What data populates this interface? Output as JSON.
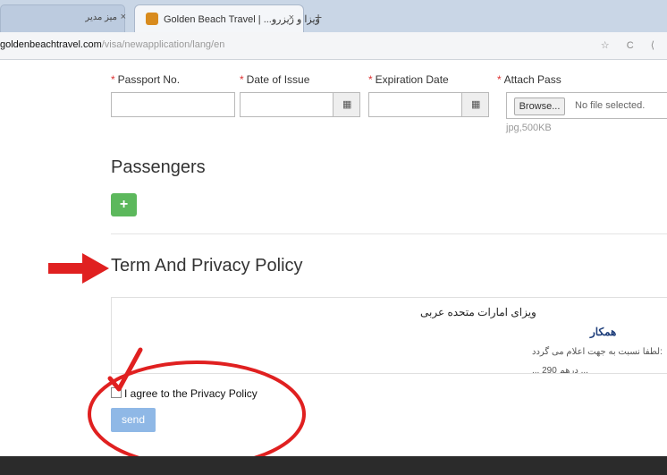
{
  "browser": {
    "tabs": [
      {
        "label": "میز مدیر",
        "close": "×",
        "active": false
      },
      {
        "label": "Golden Beach Travel | ...ویزا و ریزرو",
        "close": "×",
        "active": true
      }
    ],
    "new_tab": "+",
    "url_host": "goldenbeachtravel.com",
    "url_path": "/visa/newapplication/lang/en",
    "nav_icons": "☆ C ⟨"
  },
  "form": {
    "fields": [
      {
        "label": "Passport No.",
        "required": true
      },
      {
        "label": "Date of Issue",
        "required": true,
        "calendar": true
      },
      {
        "label": "Expiration Date",
        "required": true,
        "calendar": true
      },
      {
        "label": "Attach Pass",
        "required": true
      }
    ],
    "required_mark": "*",
    "calendar_glyph": "▦",
    "browse_label": "Browse...",
    "no_file_text": "No file selected.",
    "file_hint": "jpg,500KB"
  },
  "passengers": {
    "heading": "Passengers",
    "add_label": "+"
  },
  "policy": {
    "heading": "Term And Privacy Policy",
    "lines": [
      "ویزای امارات متحده عربی",
      "همکار",
      "لطفا نسبت به جهت اعلام می گردد:",
      "... 290 درهم ..."
    ],
    "agree_label": "I agree to the Privacy Policy",
    "send_label": "send"
  },
  "colors": {
    "add_button": "#5cb85c",
    "send_button": "#8fb8e6",
    "annotation": "#e02020"
  }
}
